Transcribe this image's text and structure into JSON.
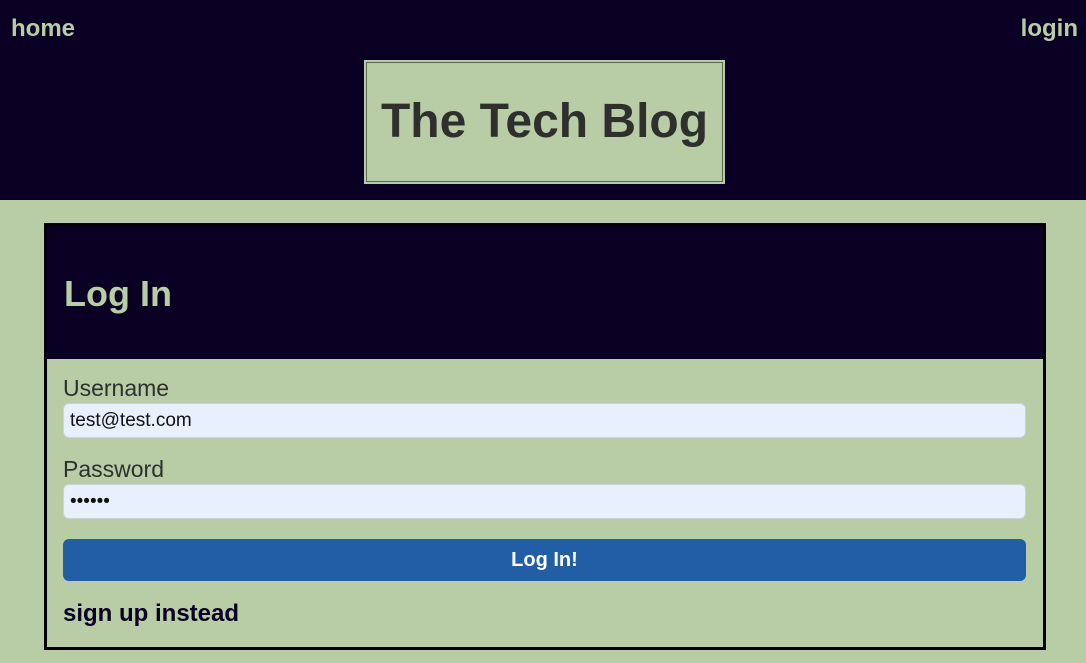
{
  "nav": {
    "home_label": "home",
    "login_label": "login"
  },
  "site": {
    "title": "The Tech Blog"
  },
  "login_card": {
    "heading": "Log In",
    "username_label": "Username",
    "username_value": "test@test.com",
    "password_label": "Password",
    "password_value": "••••••",
    "submit_label": "Log In!",
    "signup_link": "sign up instead"
  },
  "colors": {
    "dark_navy": "#090024",
    "sage_green": "#b8cca5",
    "button_blue": "#225ea5",
    "input_bg": "#e8f0fe"
  }
}
